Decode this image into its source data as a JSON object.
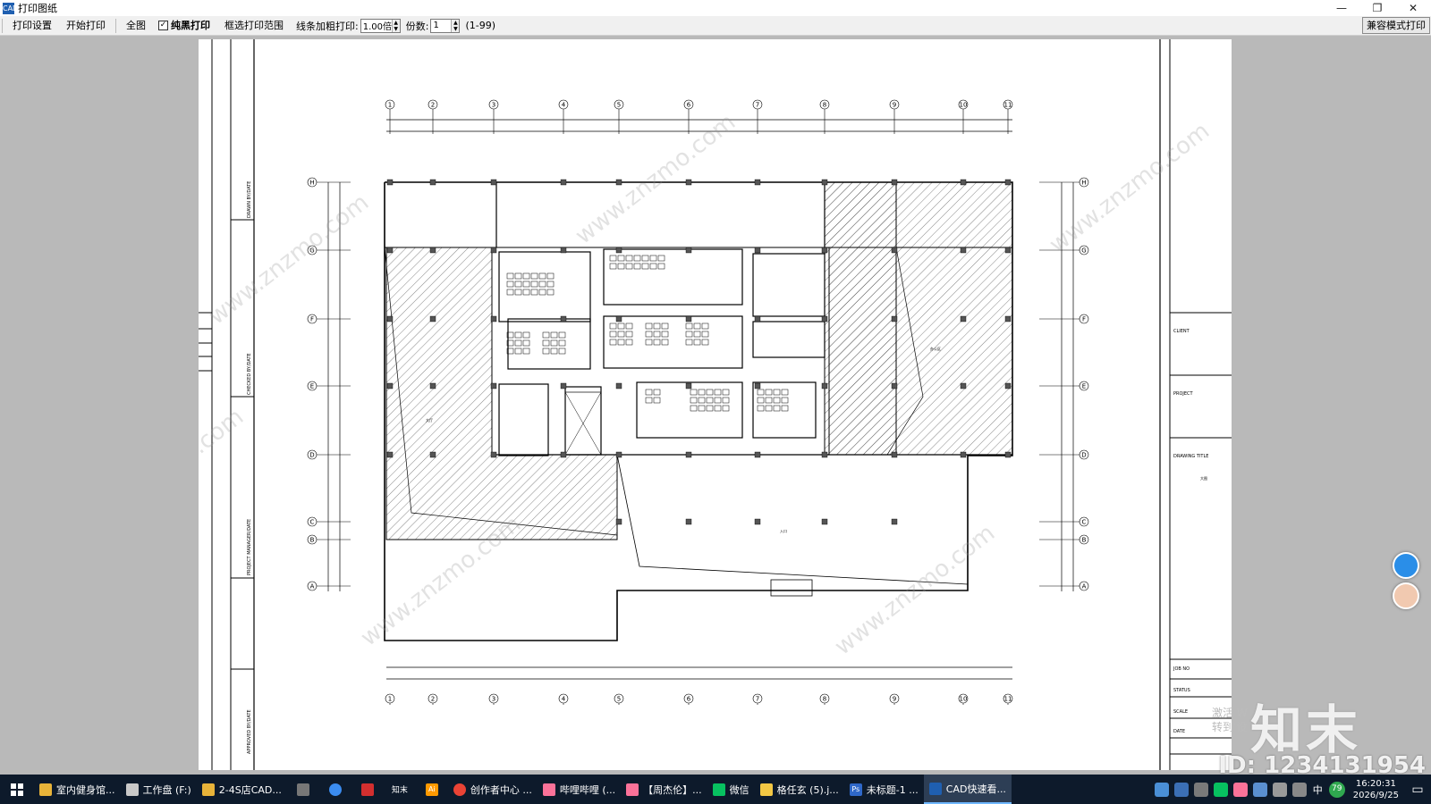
{
  "window": {
    "title": "打印图纸",
    "app_icon": "CAD"
  },
  "toolbar": {
    "print_settings": "打印设置",
    "start_print": "开始打印",
    "full_view": "全图",
    "black_print_checked": "✓",
    "black_print": "纯黑打印",
    "box_select": "框选打印范围",
    "line_bold_label": "线条加粗打印:",
    "line_bold_value": "1.00倍",
    "copies_label": "份数:",
    "copies_value": "1",
    "copies_range": "(1-99)",
    "compat_mode": "兼容模式打印"
  },
  "drawing": {
    "grid_cols": [
      "1",
      "2",
      "3",
      "4",
      "5",
      "6",
      "7",
      "8",
      "9",
      "10",
      "11"
    ],
    "grid_rows": [
      "H",
      "G",
      "F",
      "E",
      "D",
      "C",
      "B",
      "A"
    ],
    "titleblock": {
      "client": "CLIENT",
      "project": "PROJECT",
      "drawing_title": "DRAWING TITLE",
      "job_no": "JOB NO",
      "status": "STATUS",
      "scale": "SCALE",
      "date": "DATE",
      "left_drawn": "DRAWN BY/DATE",
      "left_checked": "CHECKED BY/DATE",
      "left_pm": "PROJECT MANAGER/DATE",
      "left_approved": "APPROVED BY/DATE"
    },
    "watermark": "www.znzmo.com"
  },
  "taskbar": {
    "items": [
      {
        "label": "室内健身馆...",
        "color": "#e8b339"
      },
      {
        "label": "工作盘 (F:)",
        "color": "#c9c9c9"
      },
      {
        "label": "2-4S店CAD...",
        "color": "#e8b339"
      },
      {
        "label": "创作者中心 ...",
        "color": "#ea4335"
      },
      {
        "label": "哔哩哔哩 (...",
        "color": "#fb7299"
      },
      {
        "label": "【周杰伦】...",
        "color": "#fb7299"
      },
      {
        "label": "微信",
        "color": "#07c160"
      },
      {
        "label": "格任玄 (5).j...",
        "color": "#f2c744"
      },
      {
        "label": "未标题-1 ...",
        "color": "#2f68c9"
      },
      {
        "label": "CAD快速看...",
        "color": "#1f5fb0"
      }
    ],
    "zhimo": "知末",
    "ime": "中",
    "battery": "79",
    "time": "16:20:31",
    "date": "2026/9/25"
  },
  "watermark": {
    "logo": "知末",
    "id": "ID: 1234131954",
    "activate": "激活 W",
    "activate2": "转到'设"
  }
}
